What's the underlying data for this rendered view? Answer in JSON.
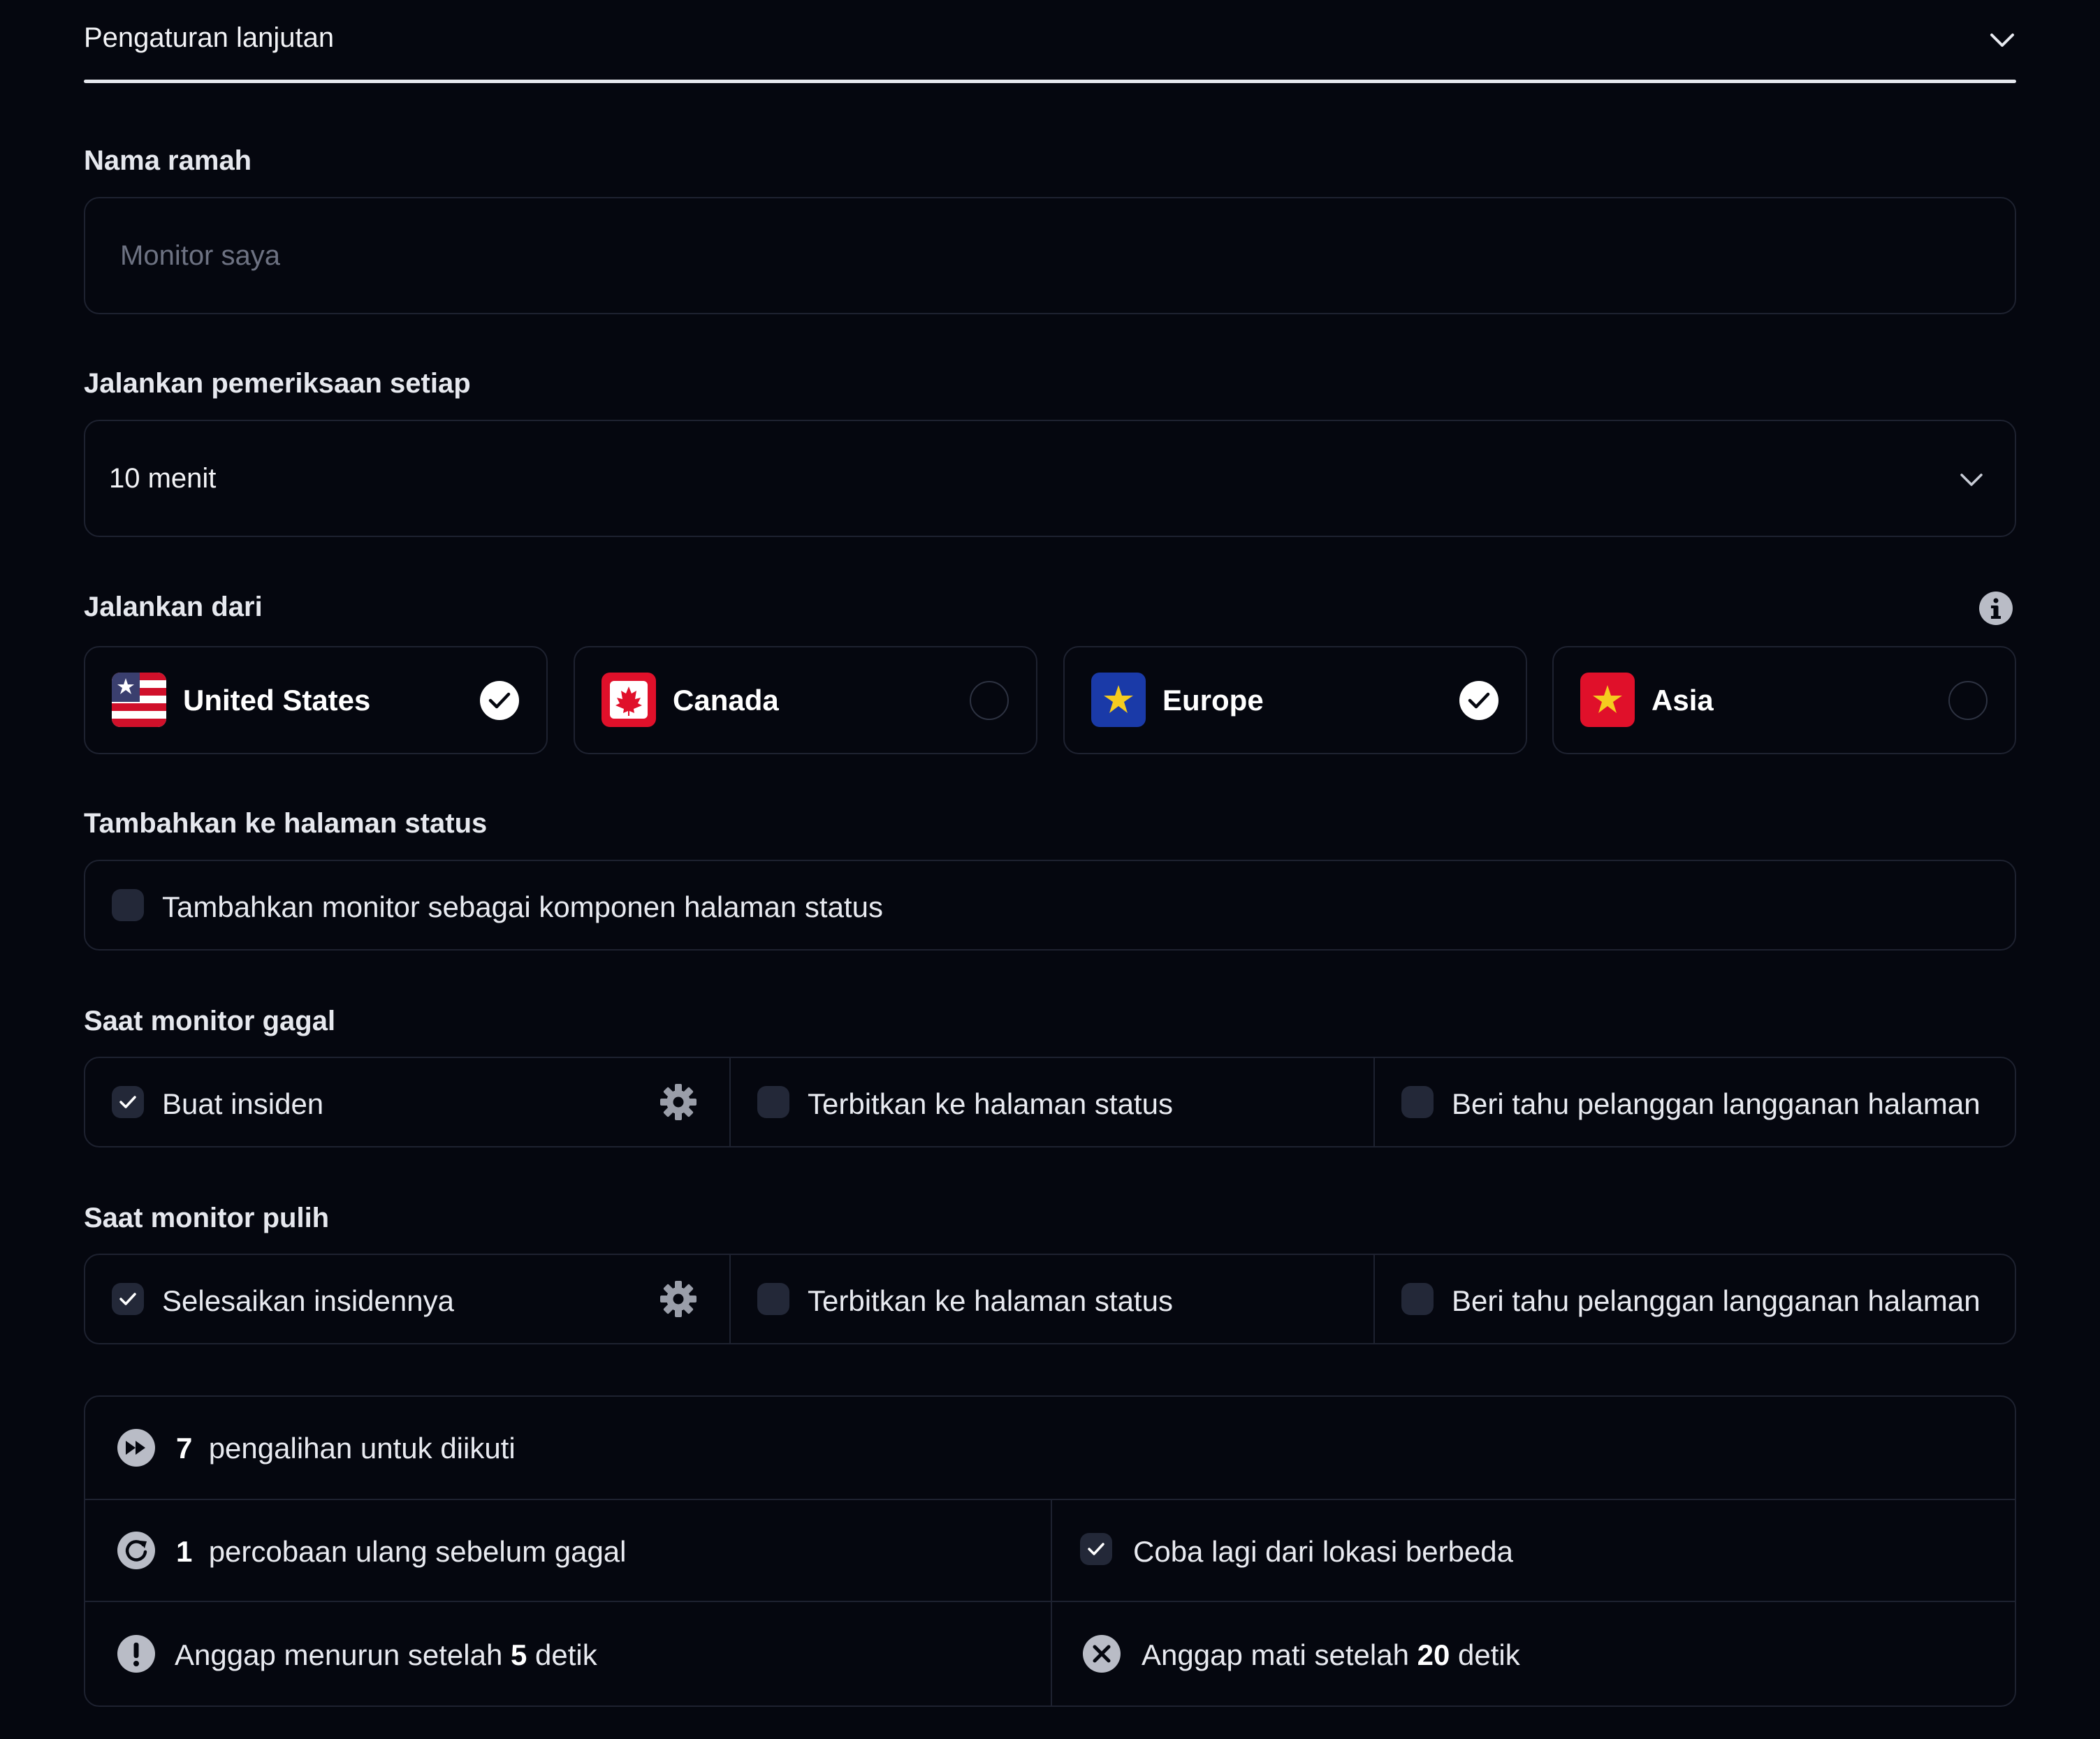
{
  "section_title": "Pengaturan lanjutan",
  "friendly_name": {
    "label": "Nama ramah",
    "placeholder": "Monitor saya",
    "value": ""
  },
  "check_interval": {
    "label": "Jalankan pemeriksaan setiap",
    "value": "10 menit"
  },
  "run_from": {
    "label": "Jalankan dari",
    "regions": [
      {
        "name": "United States",
        "selected": true
      },
      {
        "name": "Canada",
        "selected": false
      },
      {
        "name": "Europe",
        "selected": true
      },
      {
        "name": "Asia",
        "selected": false
      }
    ]
  },
  "status_page": {
    "label": "Tambahkan ke halaman status",
    "option": "Tambahkan monitor sebagai komponen halaman status",
    "checked": false
  },
  "on_fail": {
    "label": "Saat monitor gagal",
    "options": [
      {
        "text": "Buat insiden",
        "checked": true
      },
      {
        "text": "Terbitkan ke halaman status",
        "checked": false
      },
      {
        "text": "Beri tahu pelanggan langganan halaman",
        "checked": false
      }
    ]
  },
  "on_recover": {
    "label": "Saat monitor pulih",
    "options": [
      {
        "text": "Selesaikan insidennya",
        "checked": true
      },
      {
        "text": "Terbitkan ke halaman status",
        "checked": false
      },
      {
        "text": "Beri tahu pelanggan langganan halaman",
        "checked": false
      }
    ]
  },
  "summary": {
    "redirects_count": "7",
    "redirects_text": "pengalihan untuk diikuti",
    "retries_count": "1",
    "retries_text": "percobaan ulang sebelum gagal",
    "retry_other_location": "Coba lagi dari lokasi berbeda",
    "degraded_prefix": "Anggap menurun setelah",
    "degraded_value": "5",
    "degraded_suffix": "detik",
    "down_prefix": "Anggap mati setelah",
    "down_value": "20",
    "down_suffix": "detik"
  },
  "colors": {
    "background": "#05070f",
    "border": "#1e2230",
    "checkbox": "#232838",
    "text": "#e8eaf0"
  }
}
